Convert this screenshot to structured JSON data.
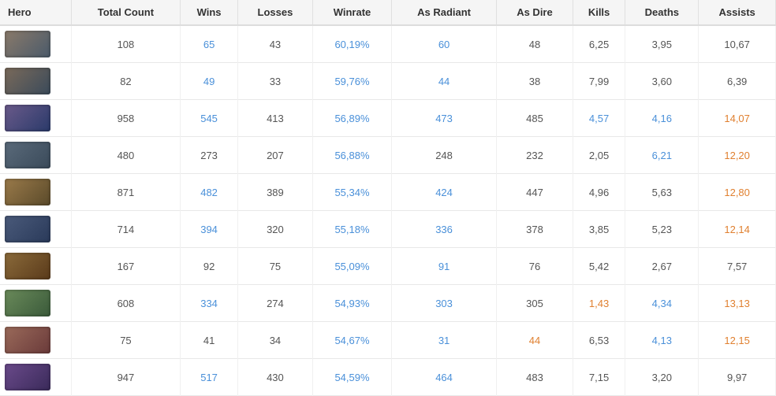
{
  "table": {
    "headers": [
      "Hero",
      "Total Count",
      "Wins",
      "Losses",
      "Winrate",
      "As Radiant",
      "As Dire",
      "Kills",
      "Deaths",
      "Assists"
    ],
    "rows": [
      {
        "heroColor": "#5a6a7a",
        "totalCount": "108",
        "wins": "65",
        "losses": "43",
        "winrate": "60,19%",
        "asRadiant": "60",
        "asDire": "48",
        "kills": "6,25",
        "deaths": "3,95",
        "assists": "10,67",
        "winsBlue": true,
        "lossesNormal": true,
        "winrateBlue": true,
        "radiantBlue": true,
        "direNormal": true,
        "killsNormal": true,
        "deathsNormal": true,
        "assistsNormal": true
      },
      {
        "heroColor": "#3a4a5a",
        "totalCount": "82",
        "wins": "49",
        "losses": "33",
        "winrate": "59,76%",
        "asRadiant": "44",
        "asDire": "38",
        "kills": "7,99",
        "deaths": "3,60",
        "assists": "6,39"
      },
      {
        "heroColor": "#2a3a4a",
        "totalCount": "958",
        "wins": "545",
        "losses": "413",
        "winrate": "56,89%",
        "asRadiant": "473",
        "asDire": "485",
        "kills": "4,57",
        "deaths": "4,16",
        "assists": "14,07"
      },
      {
        "heroColor": "#4a5a6a",
        "totalCount": "480",
        "wins": "273",
        "losses": "207",
        "winrate": "56,88%",
        "asRadiant": "248",
        "asDire": "232",
        "kills": "2,05",
        "deaths": "6,21",
        "assists": "12,20"
      },
      {
        "heroColor": "#6a5a3a",
        "totalCount": "871",
        "wins": "482",
        "losses": "389",
        "winrate": "55,34%",
        "asRadiant": "424",
        "asDire": "447",
        "kills": "4,96",
        "deaths": "5,63",
        "assists": "12,80"
      },
      {
        "heroColor": "#3a3a5a",
        "totalCount": "714",
        "wins": "394",
        "losses": "320",
        "winrate": "55,18%",
        "asRadiant": "336",
        "asDire": "378",
        "kills": "3,85",
        "deaths": "5,23",
        "assists": "12,14"
      },
      {
        "heroColor": "#6a4a2a",
        "totalCount": "167",
        "wins": "92",
        "losses": "75",
        "winrate": "55,09%",
        "asRadiant": "91",
        "asDire": "76",
        "kills": "5,42",
        "deaths": "2,67",
        "assists": "7,57"
      },
      {
        "heroColor": "#5a6a5a",
        "totalCount": "608",
        "wins": "334",
        "losses": "274",
        "winrate": "54,93%",
        "asRadiant": "303",
        "asDire": "305",
        "kills": "1,43",
        "deaths": "4,34",
        "assists": "13,13"
      },
      {
        "heroColor": "#7a5a5a",
        "totalCount": "75",
        "wins": "41",
        "losses": "34",
        "winrate": "54,67%",
        "asRadiant": "31",
        "asDire": "44",
        "kills": "6,53",
        "deaths": "4,13",
        "assists": "12,15"
      },
      {
        "heroColor": "#4a3a6a",
        "totalCount": "947",
        "wins": "517",
        "losses": "430",
        "winrate": "54,59%",
        "asRadiant": "464",
        "asDire": "483",
        "kills": "7,15",
        "deaths": "3,20",
        "assists": "9,97"
      }
    ],
    "heroColors": [
      "#5a6a7a",
      "#3a4a5a",
      "#2a3a4a",
      "#4a5a6a",
      "#6a5a3a",
      "#3a3a5a",
      "#6a4a2a",
      "#5a6a5a",
      "#7a5a5a",
      "#4a3a6a"
    ],
    "heroGradients": [
      [
        "#8a7a6a",
        "#4a5a6a"
      ],
      [
        "#7a6a5a",
        "#3a4a5a"
      ],
      [
        "#6a5a8a",
        "#2a3a6a"
      ],
      [
        "#5a6a7a",
        "#3a4a5a"
      ],
      [
        "#9a7a4a",
        "#5a4a2a"
      ],
      [
        "#4a5a7a",
        "#2a3a5a"
      ],
      [
        "#8a6a3a",
        "#5a3a1a"
      ],
      [
        "#6a8a5a",
        "#3a5a3a"
      ],
      [
        "#9a6a5a",
        "#6a3a3a"
      ],
      [
        "#6a4a8a",
        "#3a2a5a"
      ]
    ]
  }
}
